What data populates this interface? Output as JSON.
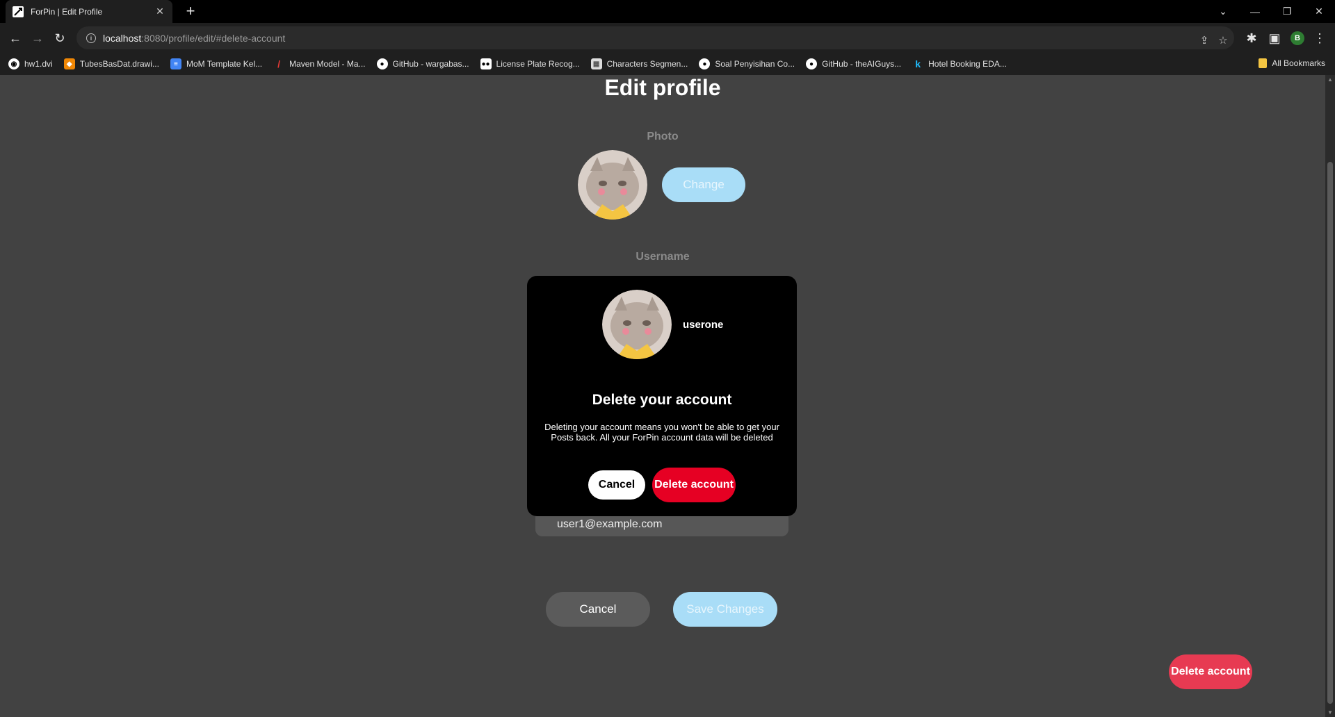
{
  "browser": {
    "tab_title": "ForPin | Edit Profile",
    "url_host": "localhost",
    "url_rest": ":8080/profile/edit/#delete-account",
    "profile_initial": "B",
    "bookmarks": [
      {
        "label": "hw1.dvi",
        "icon": "globe-icon"
      },
      {
        "label": "TubesBasDat.drawi...",
        "icon": "drawio-icon"
      },
      {
        "label": "MoM Template Kel...",
        "icon": "docs-icon"
      },
      {
        "label": "Maven Model - Ma...",
        "icon": "slash-icon"
      },
      {
        "label": "GitHub - wargabas...",
        "icon": "github-icon"
      },
      {
        "label": "License Plate Recog...",
        "icon": "medium-icon"
      },
      {
        "label": "Characters Segmen...",
        "icon": "image-icon"
      },
      {
        "label": "Soal Penyisihan Co...",
        "icon": "github-icon"
      },
      {
        "label": "GitHub - theAIGuys...",
        "icon": "github-icon"
      },
      {
        "label": "Hotel Booking EDA...",
        "icon": "kaggle-icon"
      }
    ],
    "all_bookmarks": "All Bookmarks"
  },
  "page": {
    "title": "Edit profile",
    "photo_label": "Photo",
    "change_label": "Change",
    "username_label": "Username",
    "email_value": "user1@example.com",
    "cancel_label": "Cancel",
    "save_label": "Save Changes",
    "delete_account_label": "Delete account"
  },
  "modal": {
    "username": "userone",
    "title": "Delete your account",
    "description": "Deleting your account means you won't be able to get your Posts back. All your ForPin account data will be deleted",
    "cancel_label": "Cancel",
    "delete_label": "Delete account"
  },
  "colors": {
    "page_bg": "#424242",
    "accent_blue": "#a9ddf7",
    "danger_red": "#e60023",
    "corner_red": "#e73a52"
  }
}
